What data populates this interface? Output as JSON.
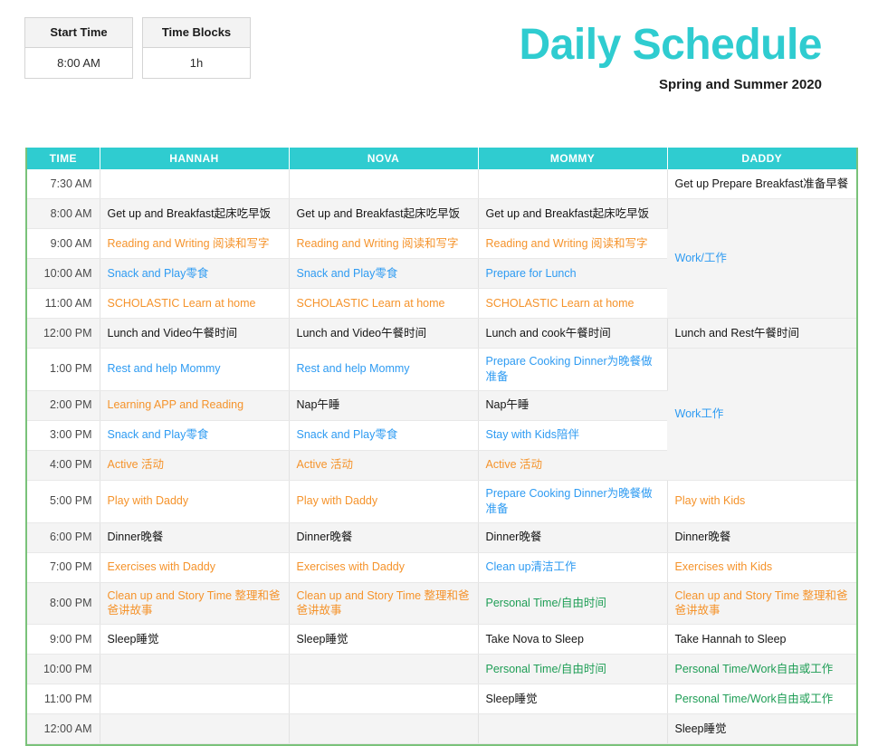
{
  "controls": {
    "start_time": {
      "label": "Start Time",
      "value": "8:00 AM"
    },
    "time_blocks": {
      "label": "Time Blocks",
      "value": "1h"
    }
  },
  "header": {
    "title": "Daily Schedule",
    "subtitle": "Spring and Summer 2020",
    "title_color": "#2fccd0"
  },
  "table": {
    "columns": [
      "TIME",
      "HANNAH",
      "NOVA",
      "MOMMY",
      "DADDY"
    ],
    "colors": {
      "header_bg": "#2fccd0",
      "header_text": "#ffffff",
      "border": "#7ac27a",
      "black": "#161616",
      "orange": "#f5932b",
      "blue": "#2e9bf2",
      "green": "#1f9e56",
      "alt_row_bg": "#f4f4f4"
    },
    "rows": [
      {
        "time": "7:30 AM",
        "hannah": "",
        "hannah_color": "black",
        "nova": "",
        "nova_color": "black",
        "mommy": "",
        "mommy_color": "black",
        "daddy": "Get up Prepare Breakfast准备早餐",
        "daddy_color": "black"
      },
      {
        "time": "8:00 AM",
        "hannah": "Get up and Breakfast起床吃早饭",
        "hannah_color": "black",
        "nova": "Get up and Breakfast起床吃早饭",
        "nova_color": "black",
        "mommy": "Get up and Breakfast起床吃早饭",
        "mommy_color": "black",
        "daddy": "Work/工作",
        "daddy_color": "blue",
        "daddy_rowspan": 4
      },
      {
        "time": "9:00 AM",
        "hannah": "Reading and Writing 阅读和写字",
        "hannah_color": "orange",
        "nova": "Reading and Writing 阅读和写字",
        "nova_color": "orange",
        "mommy": "Reading and Writing 阅读和写字",
        "mommy_color": "orange"
      },
      {
        "time": "10:00 AM",
        "hannah": "Snack and Play零食",
        "hannah_color": "blue",
        "nova": "Snack and Play零食",
        "nova_color": "blue",
        "mommy": "Prepare for Lunch",
        "mommy_color": "blue"
      },
      {
        "time": "11:00 AM",
        "hannah": "SCHOLASTIC Learn at home",
        "hannah_color": "orange",
        "nova": "SCHOLASTIC Learn at home",
        "nova_color": "orange",
        "mommy": "SCHOLASTIC Learn at home",
        "mommy_color": "orange"
      },
      {
        "time": "12:00 PM",
        "hannah": "Lunch and Video午餐时间",
        "hannah_color": "black",
        "nova": "Lunch and Video午餐时间",
        "nova_color": "black",
        "mommy": "Lunch and cook午餐时间",
        "mommy_color": "black",
        "daddy": "Lunch and Rest午餐时间",
        "daddy_color": "black"
      },
      {
        "time": "1:00 PM",
        "hannah": "Rest and help Mommy",
        "hannah_color": "blue",
        "nova": "Rest and help Mommy",
        "nova_color": "blue",
        "mommy": "Prepare Cooking Dinner为晚餐做准备",
        "mommy_color": "blue",
        "daddy": "Work工作",
        "daddy_color": "blue",
        "daddy_rowspan": 4
      },
      {
        "time": "2:00 PM",
        "hannah": "Learning APP and Reading",
        "hannah_color": "orange",
        "nova": "Nap午睡",
        "nova_color": "black",
        "mommy": "Nap午睡",
        "mommy_color": "black"
      },
      {
        "time": "3:00 PM",
        "hannah": "Snack and Play零食",
        "hannah_color": "blue",
        "nova": "Snack and Play零食",
        "nova_color": "blue",
        "mommy": "Stay with Kids陪伴",
        "mommy_color": "blue"
      },
      {
        "time": "4:00 PM",
        "hannah": "Active 活动",
        "hannah_color": "orange",
        "nova": "Active 活动",
        "nova_color": "orange",
        "mommy": "Active 活动",
        "mommy_color": "orange"
      },
      {
        "time": "5:00 PM",
        "hannah": "Play with Daddy",
        "hannah_color": "orange",
        "nova": "Play with Daddy",
        "nova_color": "orange",
        "mommy": "Prepare Cooking Dinner为晚餐做准备",
        "mommy_color": "blue",
        "daddy": "Play with Kids",
        "daddy_color": "orange"
      },
      {
        "time": "6:00 PM",
        "hannah": "Dinner晚餐",
        "hannah_color": "black",
        "nova": "Dinner晚餐",
        "nova_color": "black",
        "mommy": "Dinner晚餐",
        "mommy_color": "black",
        "daddy": "Dinner晚餐",
        "daddy_color": "black"
      },
      {
        "time": "7:00 PM",
        "hannah": "Exercises with Daddy",
        "hannah_color": "orange",
        "nova": "Exercises with Daddy",
        "nova_color": "orange",
        "mommy": "Clean up清洁工作",
        "mommy_color": "blue",
        "daddy": "Exercises with Kids",
        "daddy_color": "orange"
      },
      {
        "time": "8:00 PM",
        "hannah": "Clean up and Story Time 整理和爸爸讲故事",
        "hannah_color": "orange",
        "nova": "Clean up and Story Time 整理和爸爸讲故事",
        "nova_color": "orange",
        "mommy": "Personal Time/自由时间",
        "mommy_color": "green",
        "daddy": "Clean up and Story Time 整理和爸爸讲故事",
        "daddy_color": "orange"
      },
      {
        "time": "9:00 PM",
        "hannah": "Sleep睡觉",
        "hannah_color": "black",
        "nova": "Sleep睡觉",
        "nova_color": "black",
        "mommy": "Take Nova to Sleep",
        "mommy_color": "black",
        "daddy": "Take Hannah to Sleep",
        "daddy_color": "black"
      },
      {
        "time": "10:00 PM",
        "hannah": "",
        "hannah_color": "black",
        "nova": "",
        "nova_color": "black",
        "mommy": "Personal Time/自由时间",
        "mommy_color": "green",
        "daddy": "Personal Time/Work自由或工作",
        "daddy_color": "green"
      },
      {
        "time": "11:00 PM",
        "hannah": "",
        "hannah_color": "black",
        "nova": "",
        "nova_color": "black",
        "mommy": "Sleep睡觉",
        "mommy_color": "black",
        "daddy": "Personal Time/Work自由或工作",
        "daddy_color": "green"
      },
      {
        "time": "12:00 AM",
        "hannah": "",
        "hannah_color": "black",
        "nova": "",
        "nova_color": "black",
        "mommy": "",
        "mommy_color": "black",
        "daddy": "Sleep睡觉",
        "daddy_color": "black"
      }
    ]
  }
}
